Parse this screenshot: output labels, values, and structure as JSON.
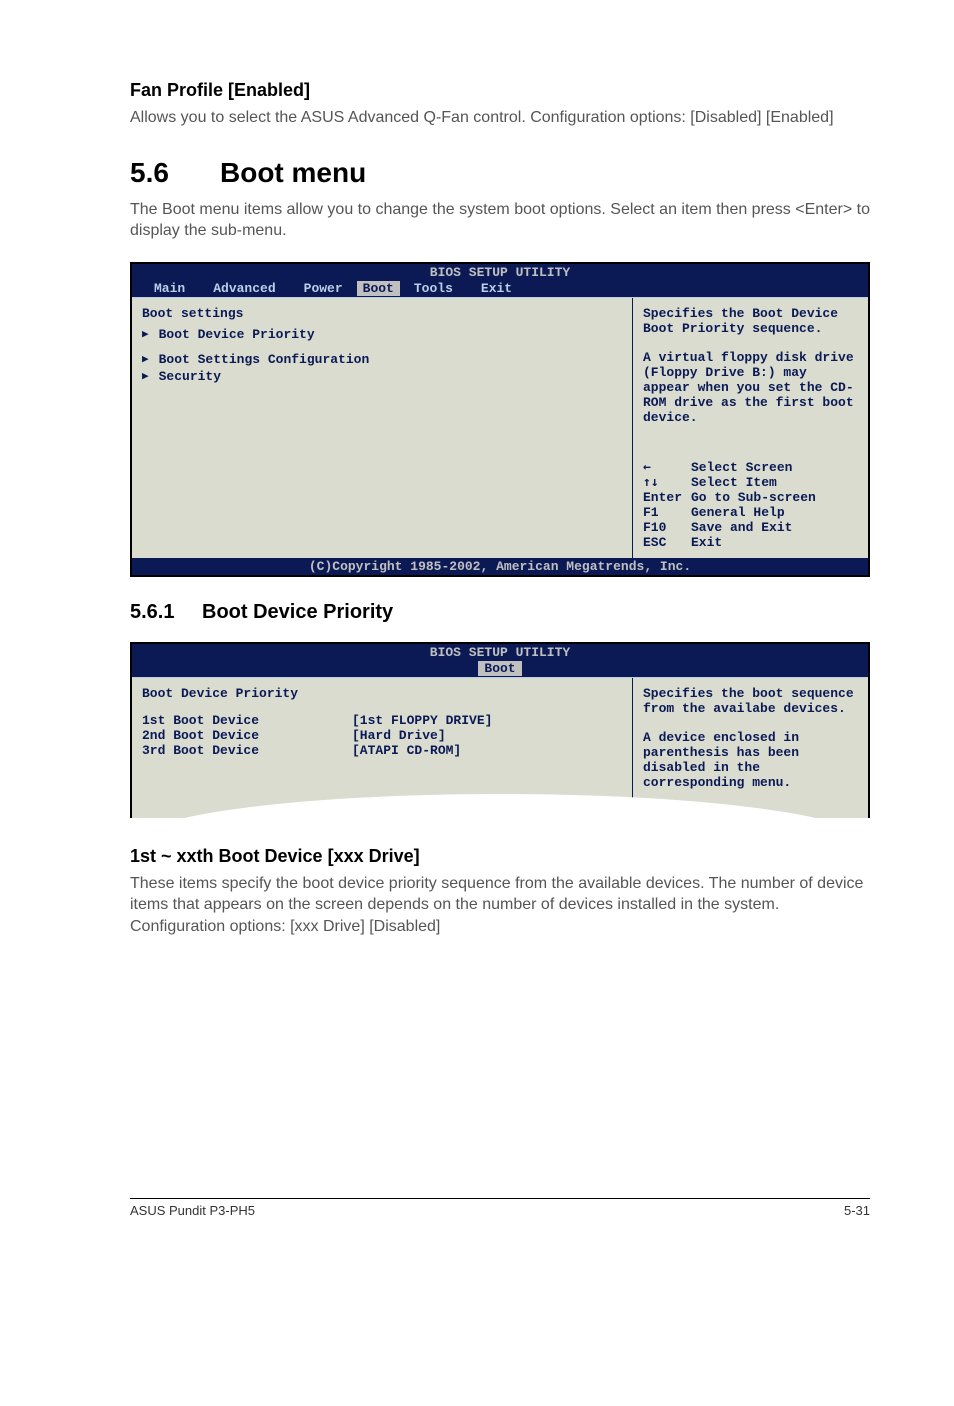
{
  "fan_profile": {
    "heading": "Fan Profile [Enabled]",
    "para": "Allows you to select the ASUS Advanced Q-Fan control. Configuration options: [Disabled] [Enabled]"
  },
  "boot_menu": {
    "num": "5.6",
    "title": "Boot menu",
    "intro": "The Boot menu items allow you to change the system boot options. Select an item then press <Enter> to display the sub-menu."
  },
  "bios1": {
    "title": "BIOS SETUP UTILITY",
    "menubar": [
      "Main",
      "Advanced",
      "Power",
      "Boot",
      "Tools",
      "Exit"
    ],
    "active_tab": "Boot",
    "left_heading": "Boot settings",
    "items": [
      "Boot Device Priority",
      "Boot Settings Configuration",
      "Security"
    ],
    "help1": "Specifies the Boot Device Boot Priority sequence.",
    "help2": "A virtual floppy disk drive (Floppy Drive B:) may appear when you set the CD-ROM drive as the first boot device.",
    "keys": [
      {
        "k": "←",
        "v": "Select Screen"
      },
      {
        "k": "↑↓",
        "v": "Select Item"
      },
      {
        "k": "Enter",
        "v": "Go to Sub-screen"
      },
      {
        "k": "F1",
        "v": "General Help"
      },
      {
        "k": "F10",
        "v": "Save and Exit"
      },
      {
        "k": "ESC",
        "v": "Exit"
      }
    ],
    "footer": "(C)Copyright 1985-2002, American Megatrends, Inc."
  },
  "sec_561": {
    "num": "5.6.1",
    "title": "Boot Device Priority"
  },
  "bios2": {
    "title": "BIOS SETUP UTILITY",
    "active_tab": "Boot",
    "left_heading": "Boot Device Priority",
    "rows": [
      {
        "name": "1st Boot Device",
        "value": "[1st FLOPPY DRIVE]"
      },
      {
        "name": "2nd Boot Device",
        "value": "[Hard Drive]"
      },
      {
        "name": "3rd Boot Device",
        "value": "[ATAPI CD-ROM]"
      }
    ],
    "help": "Specifies the boot sequence from the availabe devices.",
    "help2": "A device enclosed in parenthesis has been disabled in the corresponding menu."
  },
  "xxth": {
    "heading": "1st ~ xxth Boot Device [xxx Drive]",
    "para": "These items specify the boot device priority sequence from the available devices. The number of device items that appears on the screen depends on the number of devices installed in the system. Configuration options: [xxx Drive] [Disabled]"
  },
  "footer": {
    "left": "ASUS Pundit P3-PH5",
    "right": "5-31"
  }
}
